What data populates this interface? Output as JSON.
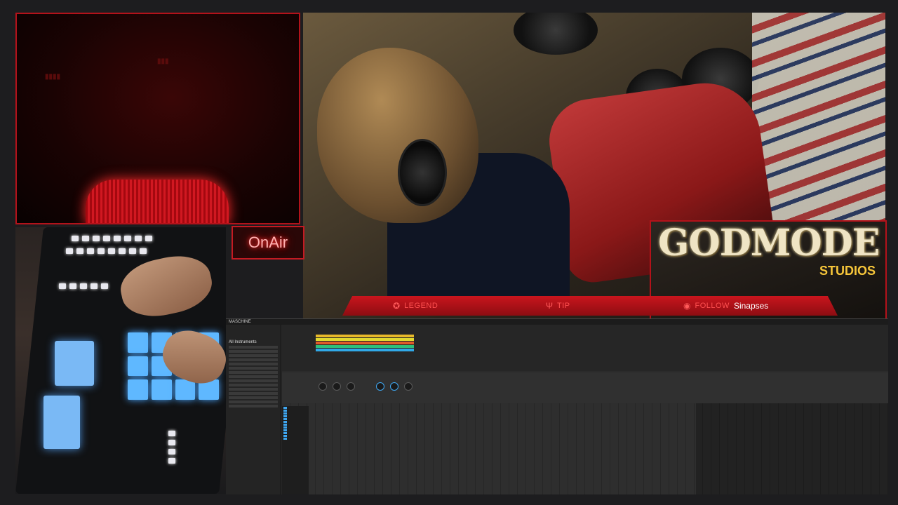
{
  "overlay": {
    "onair_label": "OnAir",
    "status_bar": {
      "legend": {
        "icon": "legend-icon",
        "label": "LEGEND",
        "value": ""
      },
      "tip": {
        "icon": "tip-icon",
        "label": "TIP",
        "value": ""
      },
      "follow": {
        "icon": "follow-icon",
        "label": "FOLLOW",
        "value": "Sinapses"
      }
    },
    "logo": {
      "title": "GODMODE",
      "subtitle": "STUDIOS"
    },
    "colors": {
      "accent": "#b3121a",
      "status_bar": "#c9151d",
      "label": "#ff5050",
      "pad_blue": "#5fb8ff"
    }
  },
  "daw": {
    "app_name": "MASCHINE",
    "browser_title": "All Instruments",
    "clip_colors": [
      "#e8b92a",
      "#e0d930",
      "#e05a2a",
      "#2fbf7a",
      "#30a9e8"
    ]
  }
}
